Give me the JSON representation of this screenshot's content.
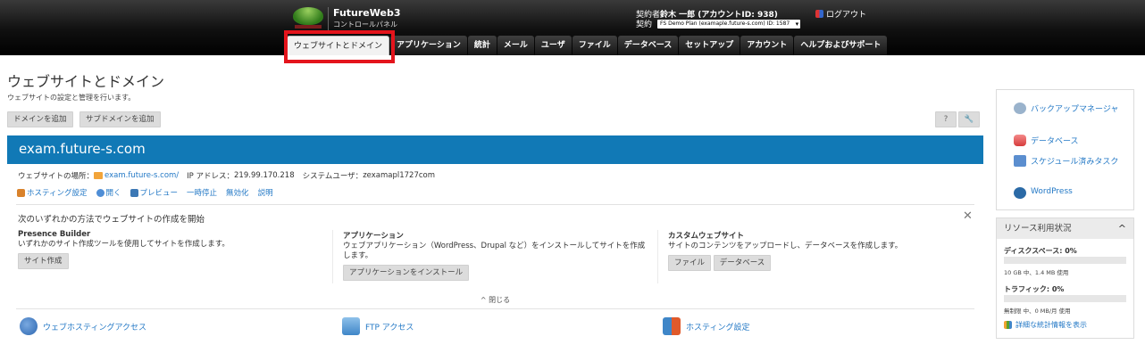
{
  "header": {
    "brand": "FutureWeb3",
    "brand_sub": "コントロールパネル",
    "account_prefix": "契約者",
    "account_name": "鈴木 一郎 (アカウントID: 938)",
    "contract_label": "契約",
    "plan_value": "FS Demo Plan (examaple.future-s.com) ID: 1587",
    "logout": "ログアウト"
  },
  "nav": {
    "tabs": [
      {
        "label": "ウェブサイトとドメイン",
        "active": true
      },
      {
        "label": "アプリケーション"
      },
      {
        "label": "統計"
      },
      {
        "label": "メール"
      },
      {
        "label": "ユーザ"
      },
      {
        "label": "ファイル"
      },
      {
        "label": "データベース"
      },
      {
        "label": "セットアップ"
      },
      {
        "label": "アカウント"
      },
      {
        "label": "ヘルプおよびサポート"
      }
    ]
  },
  "page": {
    "title": "ウェブサイトとドメイン",
    "description": "ウェブサイトの設定と管理を行います。",
    "add_domain": "ドメインを追加",
    "add_subdomain": "サブドメインを追加",
    "help": "?"
  },
  "domain": {
    "name": "exam.future-s.com",
    "location_label": "ウェブサイトの場所：",
    "location_value": "exam.future-s.com/",
    "ip_label": "IP アドレス：",
    "ip_value": "219.99.170.218",
    "sysuser_label": "システムユーザ：",
    "sysuser_value": "zexamapl1727com",
    "links": [
      "ホスティング設定",
      "開く",
      "プレビュー",
      "一時停止",
      "無効化",
      "説明"
    ]
  },
  "start": {
    "heading": "次のいずれかの方法でウェブサイトの作成を開始",
    "options": [
      {
        "title": "Presence Builder",
        "desc": "いずれかのサイト作成ツールを使用してサイトを作成します。",
        "buttons": [
          "サイト作成"
        ]
      },
      {
        "title": "アプリケーション",
        "desc": "ウェブアプリケーション（WordPress、Drupal など）をインストールしてサイトを作成します。",
        "buttons": [
          "アプリケーションをインストール"
        ]
      },
      {
        "title": "カスタムウェブサイト",
        "desc": "サイトのコンテンツをアップロードし、データベースを作成します。",
        "buttons": [
          "ファイル",
          "データベース"
        ]
      }
    ],
    "collapse": "閉じる"
  },
  "bottom_links": [
    "ウェブホスティングアクセス",
    "FTP アクセス",
    "ホスティング設定"
  ],
  "sidebar": {
    "quick_links": [
      "バックアップマネージャ",
      "データベース",
      "スケジュール済みタスク",
      "WordPress"
    ],
    "resources": {
      "title": "リソース利用状況",
      "disk_label": "ディスクスペース: 0%",
      "disk_used_pct": 0,
      "disk_detail": "10 GB 中、1.4 MB 使用",
      "traffic_label": "トラフィック: 0%",
      "traffic_used_pct": 0,
      "traffic_detail": "無制限 中、0 MB/月 使用",
      "stats_link": "詳細な統計情報を表示"
    }
  },
  "colors": {
    "domain_bar": "#1179b6",
    "link": "#2479c6",
    "highlight": "#e4141c"
  }
}
